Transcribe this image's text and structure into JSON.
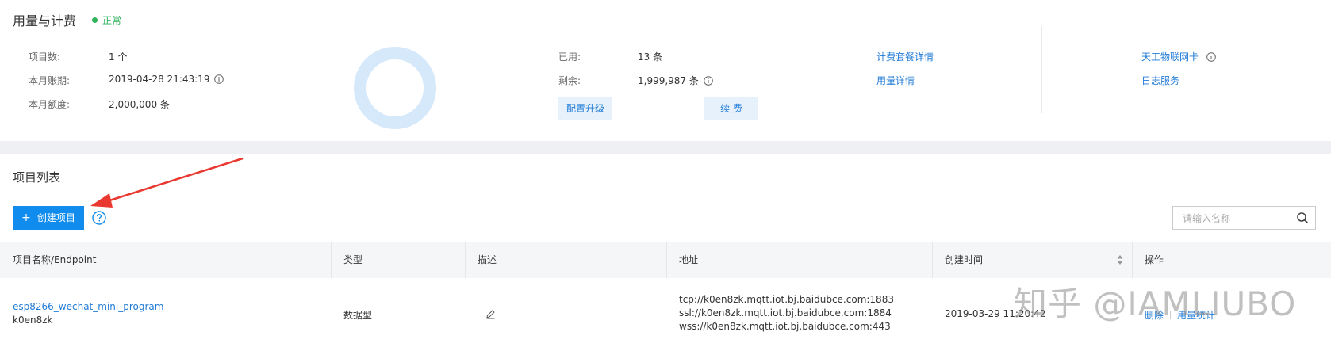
{
  "usage": {
    "title": "用量与计费",
    "status": "正常",
    "project_count_label": "项目数:",
    "project_count_value": "1 个",
    "billing_period_label": "本月账期:",
    "billing_period_value": "2019-04-28 21:43:19",
    "quota_label": "本月额度:",
    "quota_value": "2,000,000 条",
    "used_label": "已用:",
    "used_value": "13 条",
    "remaining_label": "剩余:",
    "remaining_value": "1,999,987 条",
    "upgrade_button": "配置升级",
    "renew_button": "续 费",
    "plan_details_link": "计费套餐详情",
    "usage_details_link": "用量详情",
    "iot_card_link": "天工物联网卡",
    "log_service_link": "日志服务"
  },
  "project_list": {
    "title": "项目列表",
    "create_button": "创建项目",
    "search_placeholder": "请输入名称",
    "columns": [
      "项目名称/Endpoint",
      "类型",
      "描述",
      "地址",
      "创建时间",
      "操作"
    ],
    "rows": [
      {
        "name": "esp8266_wechat_mini_program",
        "endpoint": "k0en8zk",
        "type": "数据型",
        "addresses": [
          "tcp://k0en8zk.mqtt.iot.bj.baidubce.com:1883",
          "ssl://k0en8zk.mqtt.iot.bj.baidubce.com:1884",
          "wss://k0en8zk.mqtt.iot.bj.baidubce.com:443"
        ],
        "created": "2019-03-29 11:20:42",
        "action_delete": "删除",
        "action_stats": "用量统计"
      }
    ]
  },
  "watermark": "知乎 @IAMLIUBO",
  "colors": {
    "accent": "#108cee",
    "link": "#1e7ad6",
    "status_ok": "#2fb35b",
    "ring": "#d6e9fb",
    "arrow": "#e8382f"
  }
}
